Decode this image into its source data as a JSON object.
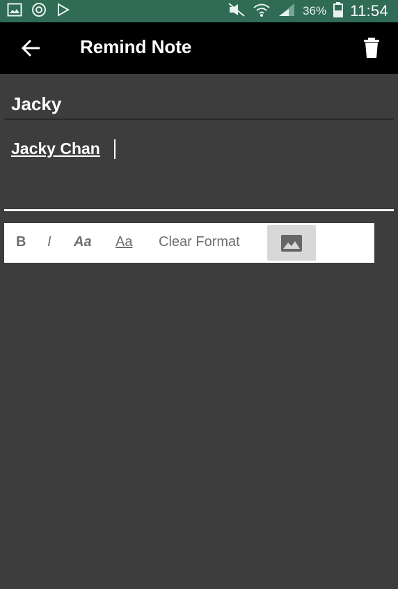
{
  "status_bar": {
    "left_icons": [
      "image-notification-icon",
      "at-sign-icon",
      "play-store-icon"
    ],
    "right_icons": [
      "vibrate-silent-icon",
      "wifi-icon",
      "signal-icon"
    ],
    "battery_text": "36%",
    "time_text": "11:54",
    "bar_color": "#2f6b55"
  },
  "app_bar": {
    "title": "Remind Note",
    "back_icon": "arrow-back-icon",
    "delete_icon": "trash-icon"
  },
  "note": {
    "subject": "Jacky",
    "body": "Jacky Chan"
  },
  "toolbar": {
    "bold_label": "B",
    "italic_label": "I",
    "font_style_label": "Aa",
    "underline_label": "Aa",
    "clear_format_label": "Clear Format",
    "image_icon": "image-icon"
  },
  "colors": {
    "background": "#3d3d3d",
    "appbar": "#000000",
    "toolbar": "#ffffff"
  }
}
